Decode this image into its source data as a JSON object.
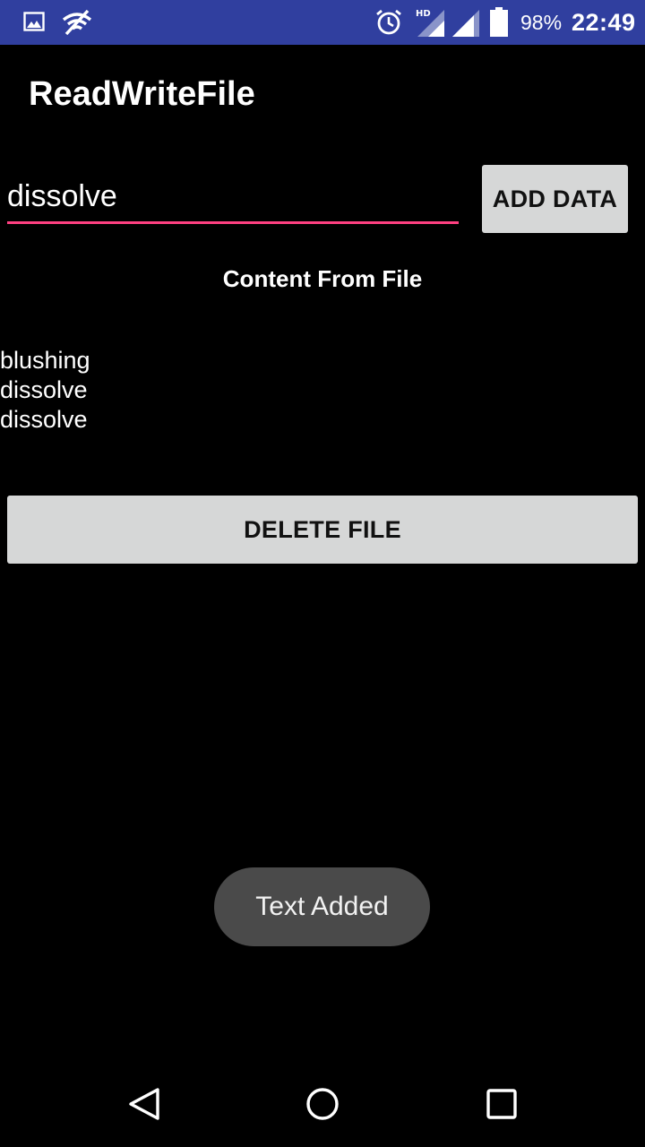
{
  "status_bar": {
    "battery_percent": "98%",
    "time": "22:49",
    "network_badge": "HD"
  },
  "app": {
    "title": "ReadWriteFile"
  },
  "input": {
    "value": "dissolve"
  },
  "buttons": {
    "add_data": "ADD DATA",
    "delete_file": "DELETE FILE"
  },
  "content": {
    "heading": "Content From File",
    "lines": [
      "blushing",
      "dissolve",
      "dissolve"
    ]
  },
  "toast": {
    "message": "Text Added"
  },
  "colors": {
    "status_bar": "#303f9f",
    "accent": "#ff4081",
    "button": "#d6d7d7",
    "toast": "#4a4a4a"
  },
  "icons": {
    "status_left": [
      "image-icon",
      "wifi-off-icon"
    ],
    "status_right": [
      "alarm-icon",
      "signal-hd-icon",
      "signal-icon",
      "battery-icon"
    ],
    "nav": [
      "back-icon",
      "home-icon",
      "recents-icon"
    ]
  }
}
